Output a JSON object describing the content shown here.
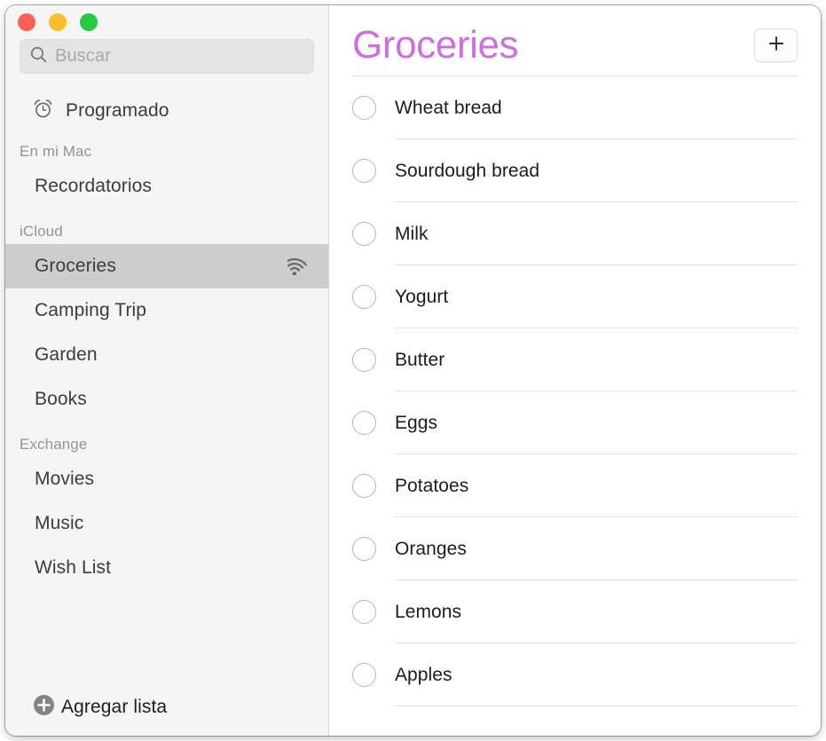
{
  "window": {
    "traffic_lights": [
      {
        "name": "close-button",
        "color": "#ff5f57"
      },
      {
        "name": "minimize-button",
        "color": "#febc2e"
      },
      {
        "name": "zoom-button",
        "color": "#28c840"
      }
    ]
  },
  "sidebar": {
    "search": {
      "placeholder": "Buscar",
      "value": "",
      "icon": "search-icon"
    },
    "smart_lists": [
      {
        "label": "Programado",
        "icon": "alarm-clock-icon"
      }
    ],
    "groups": [
      {
        "header": "En mi Mac",
        "items": [
          {
            "label": "Recordatorios",
            "selected": false,
            "shared": false
          }
        ]
      },
      {
        "header": "iCloud",
        "items": [
          {
            "label": "Groceries",
            "selected": true,
            "shared": true,
            "badge_icon": "shared-list-icon"
          },
          {
            "label": "Camping Trip",
            "selected": false,
            "shared": false
          },
          {
            "label": "Garden",
            "selected": false,
            "shared": false
          },
          {
            "label": "Books",
            "selected": false,
            "shared": false
          }
        ]
      },
      {
        "header": "Exchange",
        "items": [
          {
            "label": "Movies",
            "selected": false,
            "shared": false
          },
          {
            "label": "Music",
            "selected": false,
            "shared": false
          },
          {
            "label": "Wish List",
            "selected": false,
            "shared": false
          }
        ]
      }
    ],
    "add_list": {
      "label": "Agregar lista",
      "icon": "plus-circle-icon"
    },
    "selection_color": "#cdcdcd",
    "background_color": "#f5f5f5"
  },
  "main": {
    "title": "Groceries",
    "title_color": "#cc70dd",
    "add_item_button": {
      "label": "+",
      "icon": "plus-icon"
    },
    "reminders": [
      {
        "label": "Wheat bread",
        "completed": false
      },
      {
        "label": "Sourdough bread",
        "completed": false
      },
      {
        "label": "Milk",
        "completed": false
      },
      {
        "label": "Yogurt",
        "completed": false
      },
      {
        "label": "Butter",
        "completed": false
      },
      {
        "label": "Eggs",
        "completed": false
      },
      {
        "label": "Potatoes",
        "completed": false
      },
      {
        "label": "Oranges",
        "completed": false
      },
      {
        "label": "Lemons",
        "completed": false
      },
      {
        "label": "Apples",
        "completed": false
      }
    ]
  }
}
